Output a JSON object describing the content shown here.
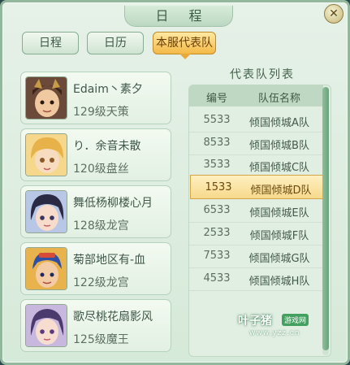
{
  "window": {
    "title": "日 程",
    "close_glyph": "✕"
  },
  "tabs": [
    {
      "label": "日程",
      "active": false
    },
    {
      "label": "日历",
      "active": false
    },
    {
      "label": "本服代表队",
      "active": true
    }
  ],
  "players": [
    {
      "name": "Edaim丶素夕",
      "level_class": "129级天策",
      "avatar": "boy-warrior-avatar"
    },
    {
      "name": "り．余音未散",
      "level_class": "120级盘丝",
      "avatar": "blonde-girl-avatar"
    },
    {
      "name": "舞低杨柳楼心月",
      "level_class": "128级龙宫",
      "avatar": "dark-hair-girl-avatar"
    },
    {
      "name": "菊部地区有-血",
      "level_class": "122级龙宫",
      "avatar": "blue-hair-boy-avatar"
    },
    {
      "name": "歌尽桃花扇影风",
      "level_class": "125级魔王",
      "avatar": "purple-hair-girl-avatar"
    }
  ],
  "team_list": {
    "title": "代表队列表",
    "headers": {
      "code": "编号",
      "name": "队伍名称"
    },
    "rows": [
      {
        "code": "5533",
        "name": "倾国倾城A队",
        "selected": false
      },
      {
        "code": "8533",
        "name": "倾国倾城B队",
        "selected": false
      },
      {
        "code": "3533",
        "name": "倾国倾城C队",
        "selected": false
      },
      {
        "code": "1533",
        "name": "倾国倾城D队",
        "selected": true
      },
      {
        "code": "6533",
        "name": "倾国倾城E队",
        "selected": false
      },
      {
        "code": "2533",
        "name": "倾国倾城F队",
        "selected": false
      },
      {
        "code": "7533",
        "name": "倾国倾城G队",
        "selected": false
      },
      {
        "code": "4533",
        "name": "倾国倾城H队",
        "selected": false
      }
    ]
  },
  "watermark": {
    "main": "叶子猪",
    "badge": "游戏网",
    "url": "www.yzz.cn"
  },
  "colors": {
    "accent_active_tab": "#f3b947",
    "selected_row": "#f6d98b",
    "panel_bg": "#d6ead9"
  }
}
